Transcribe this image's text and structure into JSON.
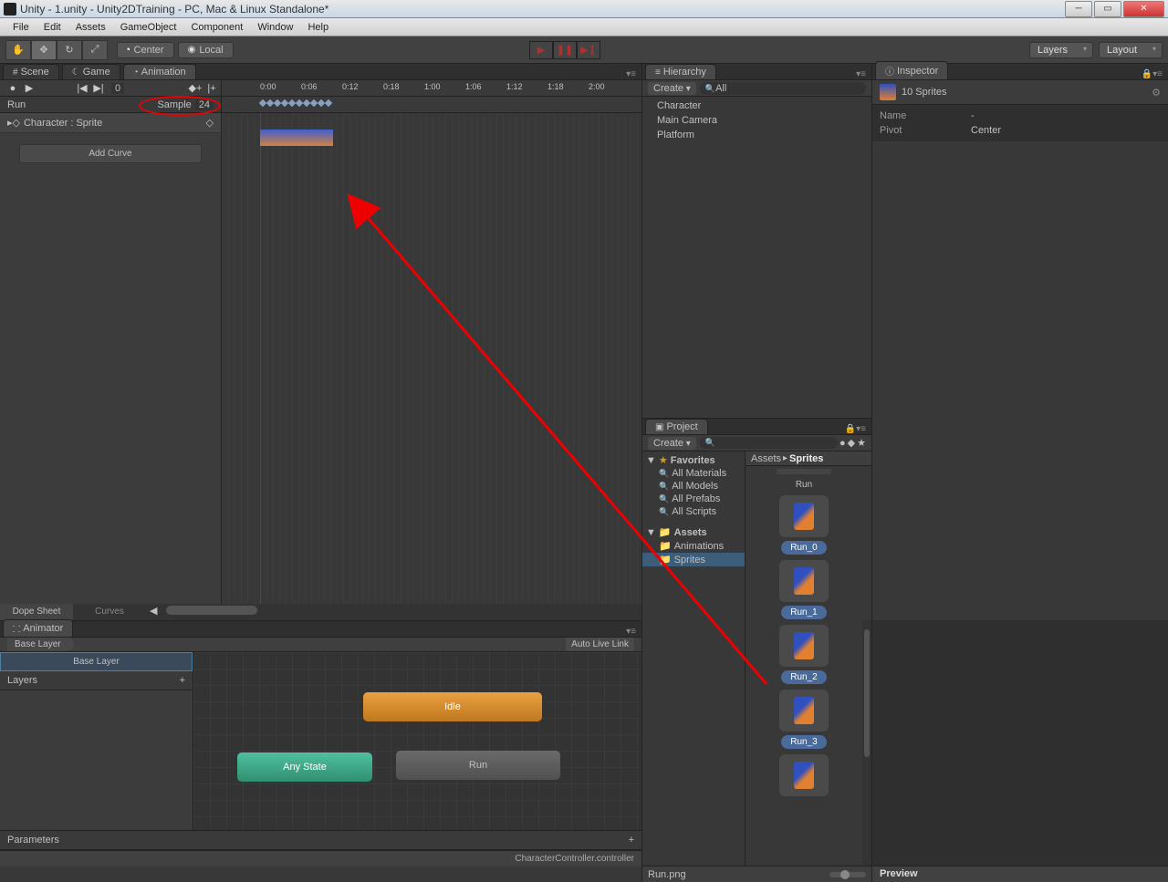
{
  "title": "Unity - 1.unity - Unity2DTraining - PC, Mac & Linux Standalone*",
  "menu": [
    "File",
    "Edit",
    "Assets",
    "GameObject",
    "Component",
    "Window",
    "Help"
  ],
  "toolbar": {
    "center": "Center",
    "local": "Local",
    "layers": "Layers",
    "layout": "Layout"
  },
  "tabs": {
    "scene": "Scene",
    "game": "Game",
    "animation": "Animation",
    "animator": "Animator",
    "hierarchy": "Hierarchy",
    "project": "Project",
    "inspector": "Inspector"
  },
  "animation": {
    "clip_name": "Run",
    "sample_label": "Sample",
    "sample_value": "24",
    "property": "Character : Sprite",
    "add_curve": "Add Curve",
    "dope_sheet": "Dope Sheet",
    "curves": "Curves",
    "frame_value": "0",
    "time_labels": [
      "0:00",
      "0:06",
      "0:12",
      "0:18",
      "1:00",
      "1:06",
      "1:12",
      "1:18",
      "2:00"
    ]
  },
  "animator": {
    "breadcrumb": "Base Layer",
    "base_layer": "Base Layer",
    "layers": "Layers",
    "parameters": "Parameters",
    "auto_live": "Auto Live Link",
    "states": {
      "idle": "Idle",
      "any": "Any State",
      "run": "Run"
    },
    "status": "CharacterController.controller"
  },
  "hierarchy": {
    "create": "Create",
    "search_placeholder": "All",
    "items": [
      "Character",
      "Main Camera",
      "Platform"
    ]
  },
  "project": {
    "create": "Create",
    "favorites": "Favorites",
    "fav_items": [
      "All Materials",
      "All Models",
      "All Prefabs",
      "All Scripts"
    ],
    "assets": "Assets",
    "folders": [
      "Animations",
      "Sprites"
    ],
    "breadcrumb_root": "Assets",
    "breadcrumb_cur": "Sprites",
    "run_asset": "Run",
    "sprites": [
      "Run_0",
      "Run_1",
      "Run_2",
      "Run_3"
    ],
    "footer": "Run.png",
    "preview": "Preview"
  },
  "inspector": {
    "title": "10 Sprites",
    "name_label": "Name",
    "name_value": "-",
    "pivot_label": "Pivot",
    "pivot_value": "Center"
  }
}
